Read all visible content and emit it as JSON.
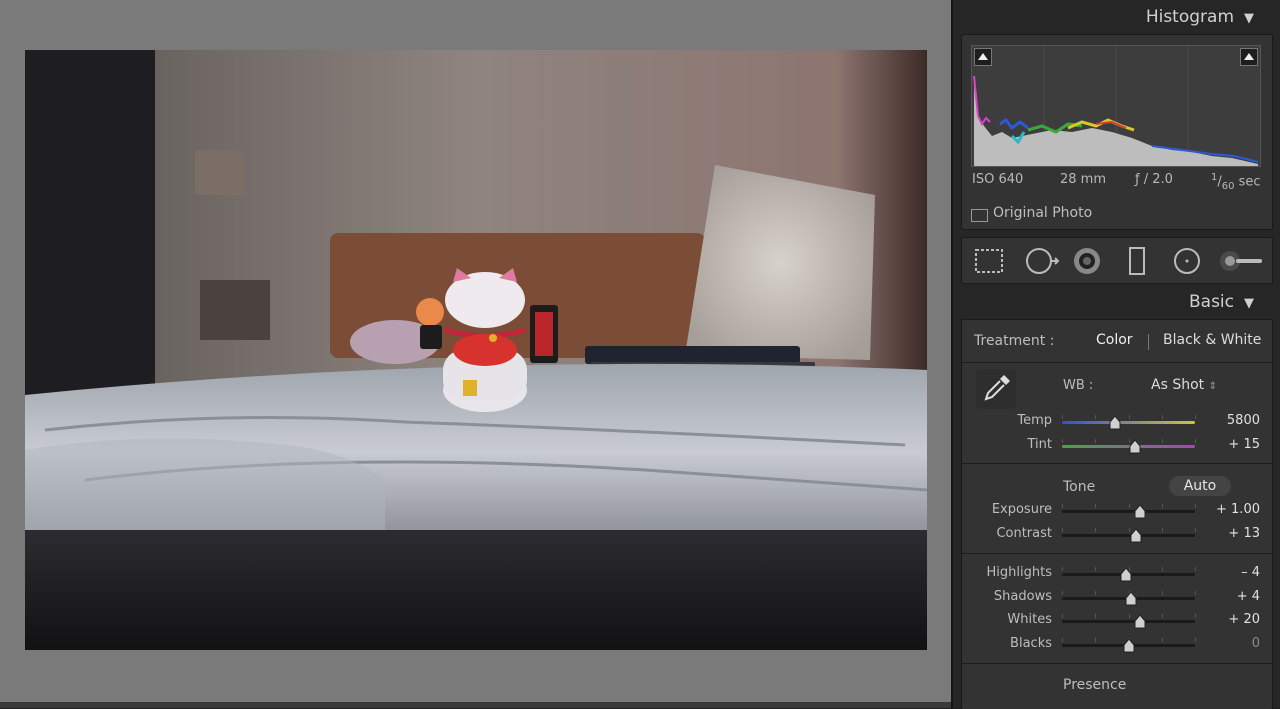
{
  "histogram": {
    "title": "Histogram",
    "iso": "ISO 640",
    "focal_length": "28 mm",
    "aperture": "ƒ / 2.0",
    "shutter_num": "1",
    "shutter_den": "60",
    "shutter_unit": "sec",
    "original_photo_label": "Original Photo"
  },
  "basic": {
    "title": "Basic",
    "treatment_label": "Treatment :",
    "treatment_color": "Color",
    "treatment_bw": "Black & White",
    "wb_label": "WB :",
    "wb_value": "As Shot",
    "tone_label": "Tone",
    "auto_label": "Auto",
    "sliders": [
      {
        "label": "Temp",
        "value": "5800",
        "pos": 0.4
      },
      {
        "label": "Tint",
        "value": "+ 15",
        "pos": 0.55
      },
      {
        "label": "Exposure",
        "value": "+ 1.00",
        "pos": 0.59
      },
      {
        "label": "Contrast",
        "value": "+ 13",
        "pos": 0.56
      },
      {
        "label": "Highlights",
        "value": "– 4",
        "pos": 0.48
      },
      {
        "label": "Shadows",
        "value": "+ 4",
        "pos": 0.52
      },
      {
        "label": "Whites",
        "value": "+ 20",
        "pos": 0.59
      },
      {
        "label": "Blacks",
        "value": "0",
        "pos": 0.5
      }
    ]
  },
  "presence": {
    "title": "Presence"
  },
  "colors": {
    "panel": "#262626",
    "viewer": "#7a7a7a",
    "accent_temp_left": "#3b4bd6",
    "accent_temp_right": "#c9c63a",
    "accent_tint_left": "#3fa84a",
    "accent_tint_right": "#b03ec0"
  }
}
